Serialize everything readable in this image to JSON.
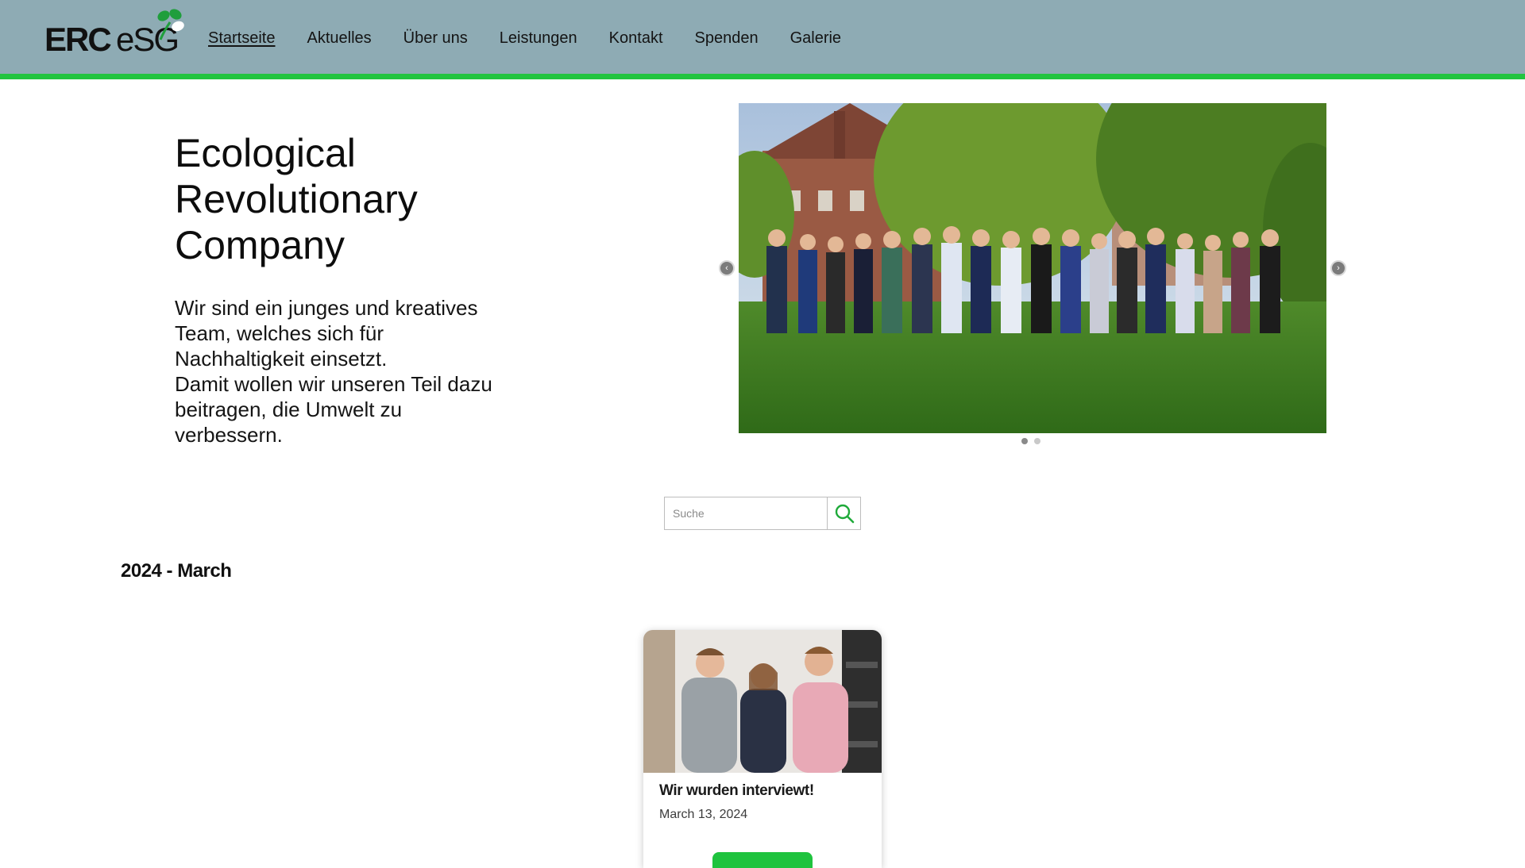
{
  "header": {
    "logo": {
      "text_primary": "ERC",
      "text_secondary": "eSG",
      "icon": "clover-leaf-icon"
    },
    "nav": [
      {
        "label": "Startseite",
        "active": true
      },
      {
        "label": "Aktuelles",
        "active": false
      },
      {
        "label": "Über uns",
        "active": false
      },
      {
        "label": "Leistungen",
        "active": false
      },
      {
        "label": "Kontakt",
        "active": false
      },
      {
        "label": "Spenden",
        "active": false
      },
      {
        "label": "Galerie",
        "active": false
      }
    ],
    "colors": {
      "background": "#8eabb4",
      "accent": "#22c43f"
    }
  },
  "hero": {
    "title": "Ecological Revolutionary Company",
    "text_line1": "Wir sind ein junges und kreatives Team, welches sich für Nachhaltigkeit einsetzt.",
    "text_line2": "Damit wollen wir unseren Teil dazu beitragen, die Umwelt zu verbessern.",
    "slider": {
      "prev_icon": "chevron-left-icon",
      "next_icon": "chevron-right-icon",
      "slide_count": 2,
      "active_slide": 1
    }
  },
  "search": {
    "placeholder": "Suche",
    "value": "",
    "icon": "search-icon"
  },
  "archive": {
    "month_heading": "2024 - March",
    "posts": [
      {
        "title": "Wir wurden interviewt!",
        "date": "March 13, 2024"
      }
    ]
  }
}
